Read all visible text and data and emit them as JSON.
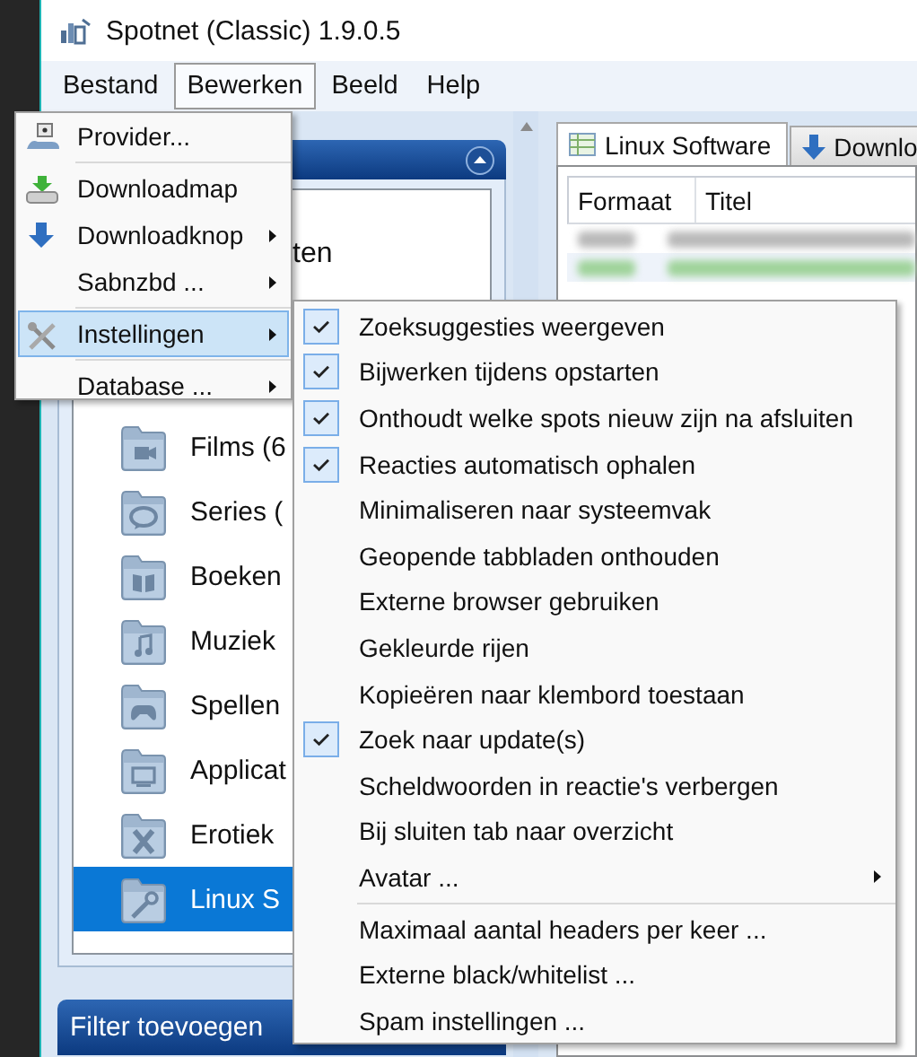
{
  "window": {
    "title": "Spotnet (Classic) 1.9.0.5"
  },
  "menubar": [
    {
      "label": "Bestand",
      "selected": false
    },
    {
      "label": "Bewerken",
      "selected": true
    },
    {
      "label": "Beeld",
      "selected": false
    },
    {
      "label": "Help",
      "selected": false
    }
  ],
  "sidebar": {
    "tree": {
      "partial_item": "ten",
      "items": [
        {
          "label": "Films (6",
          "selected": false
        },
        {
          "label": "Series (",
          "selected": false
        },
        {
          "label": "Boeken",
          "selected": false
        },
        {
          "label": "Muziek",
          "selected": false
        },
        {
          "label": "Spellen",
          "selected": false
        },
        {
          "label": "Applicat",
          "selected": false
        },
        {
          "label": "Erotiek",
          "selected": false
        },
        {
          "label": "Linux S",
          "selected": true
        }
      ]
    },
    "filter_panel": {
      "title": "Filter toevoegen"
    }
  },
  "content": {
    "tabs": [
      {
        "label": "Linux Software",
        "selected": true
      },
      {
        "label": "Downlo",
        "selected": false
      }
    ],
    "table": {
      "columns": [
        "Formaat",
        "Titel"
      ]
    }
  },
  "edit_menu": {
    "groups": [
      {
        "items": [
          {
            "label": "Provider...",
            "submenu": false,
            "selected": false
          }
        ]
      },
      {
        "items": [
          {
            "label": "Downloadmap",
            "submenu": false,
            "selected": false
          },
          {
            "label": "Downloadknop",
            "submenu": true,
            "selected": false
          },
          {
            "label": "Sabnzbd ...",
            "submenu": true,
            "selected": false
          }
        ]
      },
      {
        "items": [
          {
            "label": "Instellingen",
            "submenu": true,
            "selected": true
          }
        ]
      },
      {
        "items": [
          {
            "label": "Database ...",
            "submenu": true,
            "selected": false
          }
        ]
      }
    ]
  },
  "settings_submenu": {
    "groups": [
      {
        "items": [
          {
            "label": "Zoeksuggesties weergeven",
            "checked": true,
            "submenu": false
          },
          {
            "label": "Bijwerken tijdens opstarten",
            "checked": true,
            "submenu": false
          },
          {
            "label": "Onthoudt welke spots nieuw zijn na afsluiten",
            "checked": true,
            "submenu": false
          },
          {
            "label": "Reacties automatisch ophalen",
            "checked": true,
            "submenu": false
          },
          {
            "label": "Minimaliseren naar systeemvak",
            "checked": false,
            "submenu": false
          },
          {
            "label": "Geopende tabbladen onthouden",
            "checked": false,
            "submenu": false
          },
          {
            "label": "Externe browser gebruiken",
            "checked": false,
            "submenu": false
          },
          {
            "label": "Gekleurde rijen",
            "checked": false,
            "submenu": false
          },
          {
            "label": "Kopieëren naar klembord toestaan",
            "checked": false,
            "submenu": false
          },
          {
            "label": "Zoek naar update(s)",
            "checked": true,
            "submenu": false
          },
          {
            "label": "Scheldwoorden in reactie's verbergen",
            "checked": false,
            "submenu": false
          },
          {
            "label": "Bij sluiten tab naar overzicht",
            "checked": false,
            "submenu": false
          },
          {
            "label": "Avatar ...",
            "checked": false,
            "submenu": true
          }
        ]
      },
      {
        "items": [
          {
            "label": "Maximaal aantal headers per keer ...",
            "checked": false,
            "submenu": false
          },
          {
            "label": "Externe black/whitelist ...",
            "checked": false,
            "submenu": false
          },
          {
            "label": "Spam instellingen ...",
            "checked": false,
            "submenu": false
          }
        ]
      }
    ]
  }
}
